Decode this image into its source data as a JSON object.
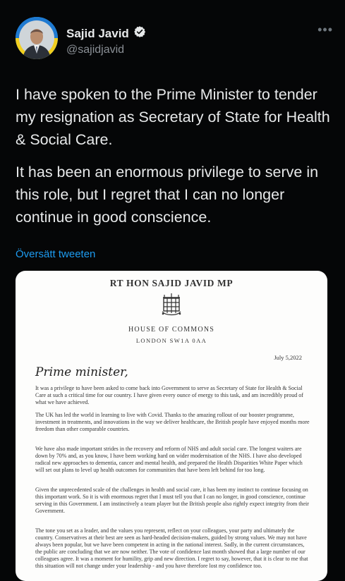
{
  "tweet": {
    "author_name": "Sajid Javid",
    "handle": "@sajidjavid",
    "more_icon": "ellipsis-icon",
    "verified_icon": "verified-badge-icon",
    "text_paragraph_1": "I have spoken to the Prime Minister to tender my resignation as Secretary of State for Health & Social Care.",
    "text_paragraph_2": "It has been an enormous privilege to serve in this role, but I regret that I can no longer continue in good conscience.",
    "translate_link": "Översätt tweeten",
    "link_color": "#1d9bf0"
  },
  "letter": {
    "title": "RT HON SAJID JAVID MP",
    "house": "HOUSE OF COMMONS",
    "address": "LONDON SW1A 0AA",
    "date": "July 5,2022",
    "salutation": "Prime minister,",
    "paragraphs": [
      "It was a privilege to have been asked to come back into Government to serve as Secretary of State for Health & Social Care at such a critical time for our country. I have given every ounce of energy to this task, and am incredibly proud of what we have achieved.",
      "The UK has led the world in learning to live with Covid. Thanks to the amazing rollout of our booster programme, investment in treatments, and innovations in the way we deliver healthcare, the British people have enjoyed months more freedom than other comparable countries.",
      "We have also made important strides in the recovery and reform of NHS and adult social care. The longest waiters are down by 70% and, as you know, I have been working hard on wider modernisation of the NHS. I have also developed radical new approaches to dementia, cancer and mental health, and prepared the Health Disparities White Paper which will set out plans to level up health outcomes for communities that have been left behind for too long.",
      "Given the unprecedented scale of the challenges in health and social care, it has been my instinct to continue focusing on this important work. So it is with enormous regret that I must tell you that I can no longer, in good conscience, continue serving in this Government. I am instinctively a team player but the British people also rightly expect integrity from their Government.",
      "The tone you set as a leader, and the values you represent, reflect on your colleagues, your party and ultimately the country. Conservatives at their best are seen as hard-headed decision-makers, guided by strong values. We may not have always been popular, but we have been competent in acting in the national interest. Sadly, in the current circumstances, the public are concluding that we are now neither. The vote of confidence last month showed that a large number of our colleagues agree. It was a moment for humility, grip and new direction. I regret to say, however, that it is clear to me that this situation will not change under your leadership - and you have therefore lost my confidence too."
    ]
  }
}
